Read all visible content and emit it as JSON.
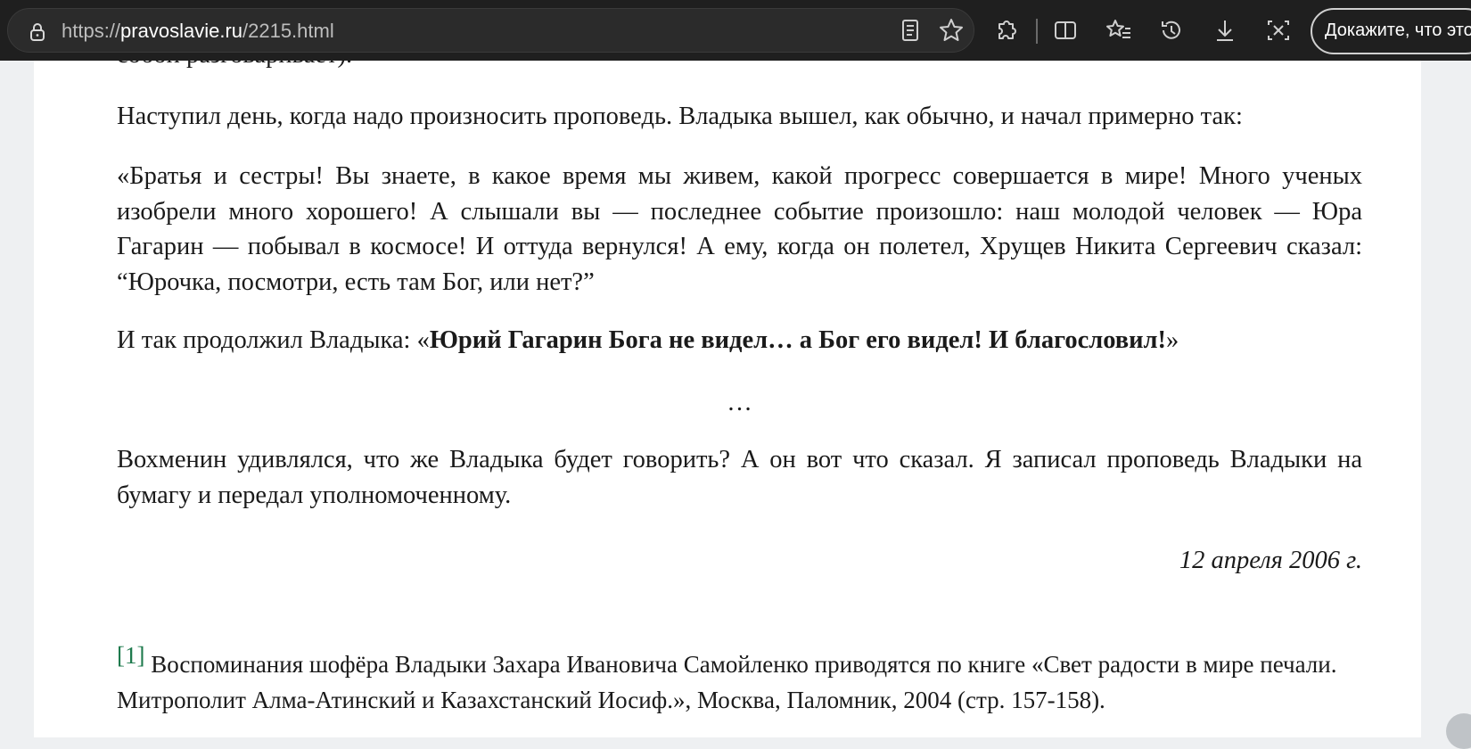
{
  "browser": {
    "url_scheme": "https://",
    "url_host": "pravoslavie.ru",
    "url_path": "/2215.html",
    "profile_button_label": "Докажите, что это"
  },
  "icons": [
    "lock-icon",
    "reader-view-icon",
    "favorite-star-icon",
    "extensions-icon",
    "split-screen-icon",
    "favorites-list-icon",
    "history-icon",
    "download-icon",
    "screenshot-icon"
  ],
  "article": {
    "cut_line": "собой разговаривает).",
    "paragraph_1": "Наступил день, когда надо произносить проповедь. Владыка вышел, как обычно, и начал примерно так:",
    "paragraph_2": "«Братья и сестры! Вы знаете, в какое время мы живем, какой прогресс совершается в мире! Много ученых изобрели много хорошего! А слышали вы — последнее событие произошло: наш молодой человек — Юра Гагарин — побывал в космосе! И оттуда вернулся! А ему, когда он полетел, Хрущев Никита Сергеевич сказал: “Юрочка, посмотри, есть там Бог, или нет?”",
    "paragraph_3_lead": "И так продолжил Владыка: «",
    "paragraph_3_bold": "Юрий Гагарин Бога не видел… а Бог его видел! И благословил!",
    "paragraph_3_end": "»",
    "separator": "…",
    "paragraph_4": "Вохменин удивлялся, что же Владыка будет говорить? А он вот что сказал. Я записал проповедь Владыки на бумагу и передал уполномоченному.",
    "date": "12 апреля 2006 г.",
    "footnote_ref": "[1]",
    "footnote_text": "Воспоминания шофёра Владыки Захара Ивановича Самойленко приводятся по книге «Свет радости в мире печали. Митрополит Алма-Атинский и Казахстанский Иосиф.», Москва, Паломник, 2004 (стр. 157-158)."
  },
  "colors": {
    "toolbar_bg": "#1f1f1f",
    "page_bg": "#eef0f2",
    "footnote_link": "#1e7a4d"
  }
}
